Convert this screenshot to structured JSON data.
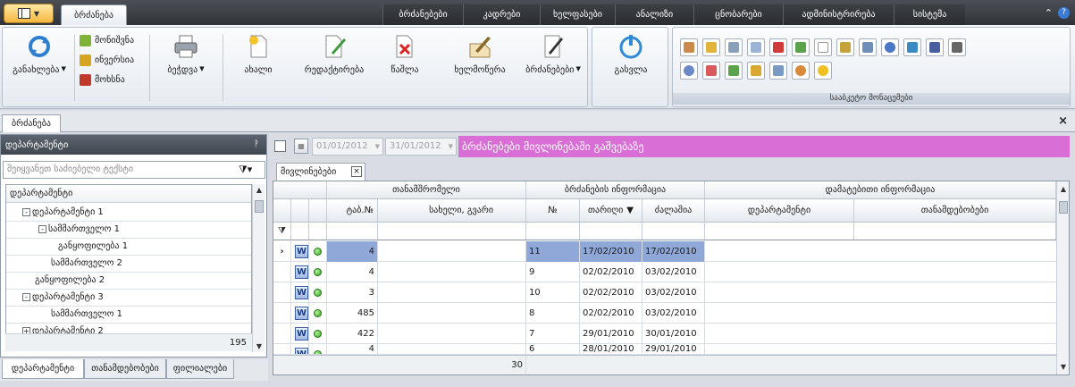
{
  "ribbon_tabs": [
    "ბრძანება",
    "ბრძანებები",
    "კადრები",
    "ხელფასები",
    "ანალიზი",
    "ცნობარები",
    "ადმინისტრირება",
    "სისტემა"
  ],
  "ribbon": {
    "refresh_label": "განახლება",
    "small_buttons": [
      "მონიშვნა",
      "ინვერსია",
      "მოხსნა"
    ],
    "print_label": "ბეჭდვა",
    "new_label": "ახალი",
    "edit_label": "რედაქტირება",
    "delete_label": "წაშლა",
    "sign_label": "ხელმოწერა",
    "orders_label": "ბრძანებები",
    "exit_label": "გასვლა",
    "quick_group_label": "სააბკეტო მონაცემები"
  },
  "doc_tab": "ბრძანება",
  "left_panel": {
    "title": "დეპარტამენტი",
    "search_placeholder": "შეიყვანეთ საძიებელი ტექსტი",
    "tree_root": "დეპარტამენტი",
    "tree": [
      {
        "label": "დეპარტამენტი 1",
        "level": 1,
        "toggle": "-"
      },
      {
        "label": "სამმართველო 1",
        "level": 2,
        "toggle": "-"
      },
      {
        "label": "განყოფილება 1",
        "level": 3,
        "toggle": ""
      },
      {
        "label": "სამმართველო 2",
        "level": 2,
        "toggle": ""
      },
      {
        "label": "განყოფილება 2",
        "level": 1,
        "toggle": ""
      },
      {
        "label": "დეპარტამენტი 3",
        "level": 1,
        "toggle": "-"
      },
      {
        "label": "სამმართველო 1",
        "level": 2,
        "toggle": ""
      },
      {
        "label": "დეპარტამენტი 2",
        "level": 1,
        "toggle": "+"
      }
    ],
    "count": "195",
    "tabs": [
      "დეპარტამენტი",
      "თანამდებობები",
      "ფილიალები"
    ]
  },
  "filter": {
    "date_from": "01/01/2012",
    "date_to": "31/01/2012",
    "banner": "ბრძანებები მივლინებაში გაშვებაზე"
  },
  "subtab": "მივლინებები",
  "grid": {
    "group_headers": [
      "თანამშრომელი",
      "ბრძანების ინფორმაცია",
      "დამატებითი ინფორმაცია"
    ],
    "columns": [
      "ტაბ.№",
      "სახელი, გვარი",
      "№",
      "თარიღი",
      "ძალაშია",
      "დეპარტამენტი",
      "თანამდებობები"
    ],
    "sort_indicator": "▼",
    "rows": [
      {
        "tab": "4",
        "name": "",
        "no": "11",
        "date": "17/02/2010",
        "valid": "17/02/2010"
      },
      {
        "tab": "4",
        "name": "",
        "no": "9",
        "date": "02/02/2010",
        "valid": "03/02/2010"
      },
      {
        "tab": "3",
        "name": "",
        "no": "10",
        "date": "02/02/2010",
        "valid": "03/02/2010"
      },
      {
        "tab": "485",
        "name": "",
        "no": "8",
        "date": "02/02/2010",
        "valid": "03/02/2010"
      },
      {
        "tab": "422",
        "name": "",
        "no": "7",
        "date": "29/01/2010",
        "valid": "30/01/2010"
      },
      {
        "tab": "4",
        "name": "",
        "no": "6",
        "date": "28/01/2010",
        "valid": "29/01/2010"
      }
    ],
    "summary_count": "30"
  },
  "colors": {
    "banner": "#d96fd6",
    "selection": "#8fa8d8",
    "status_green": "#2ea51a"
  }
}
